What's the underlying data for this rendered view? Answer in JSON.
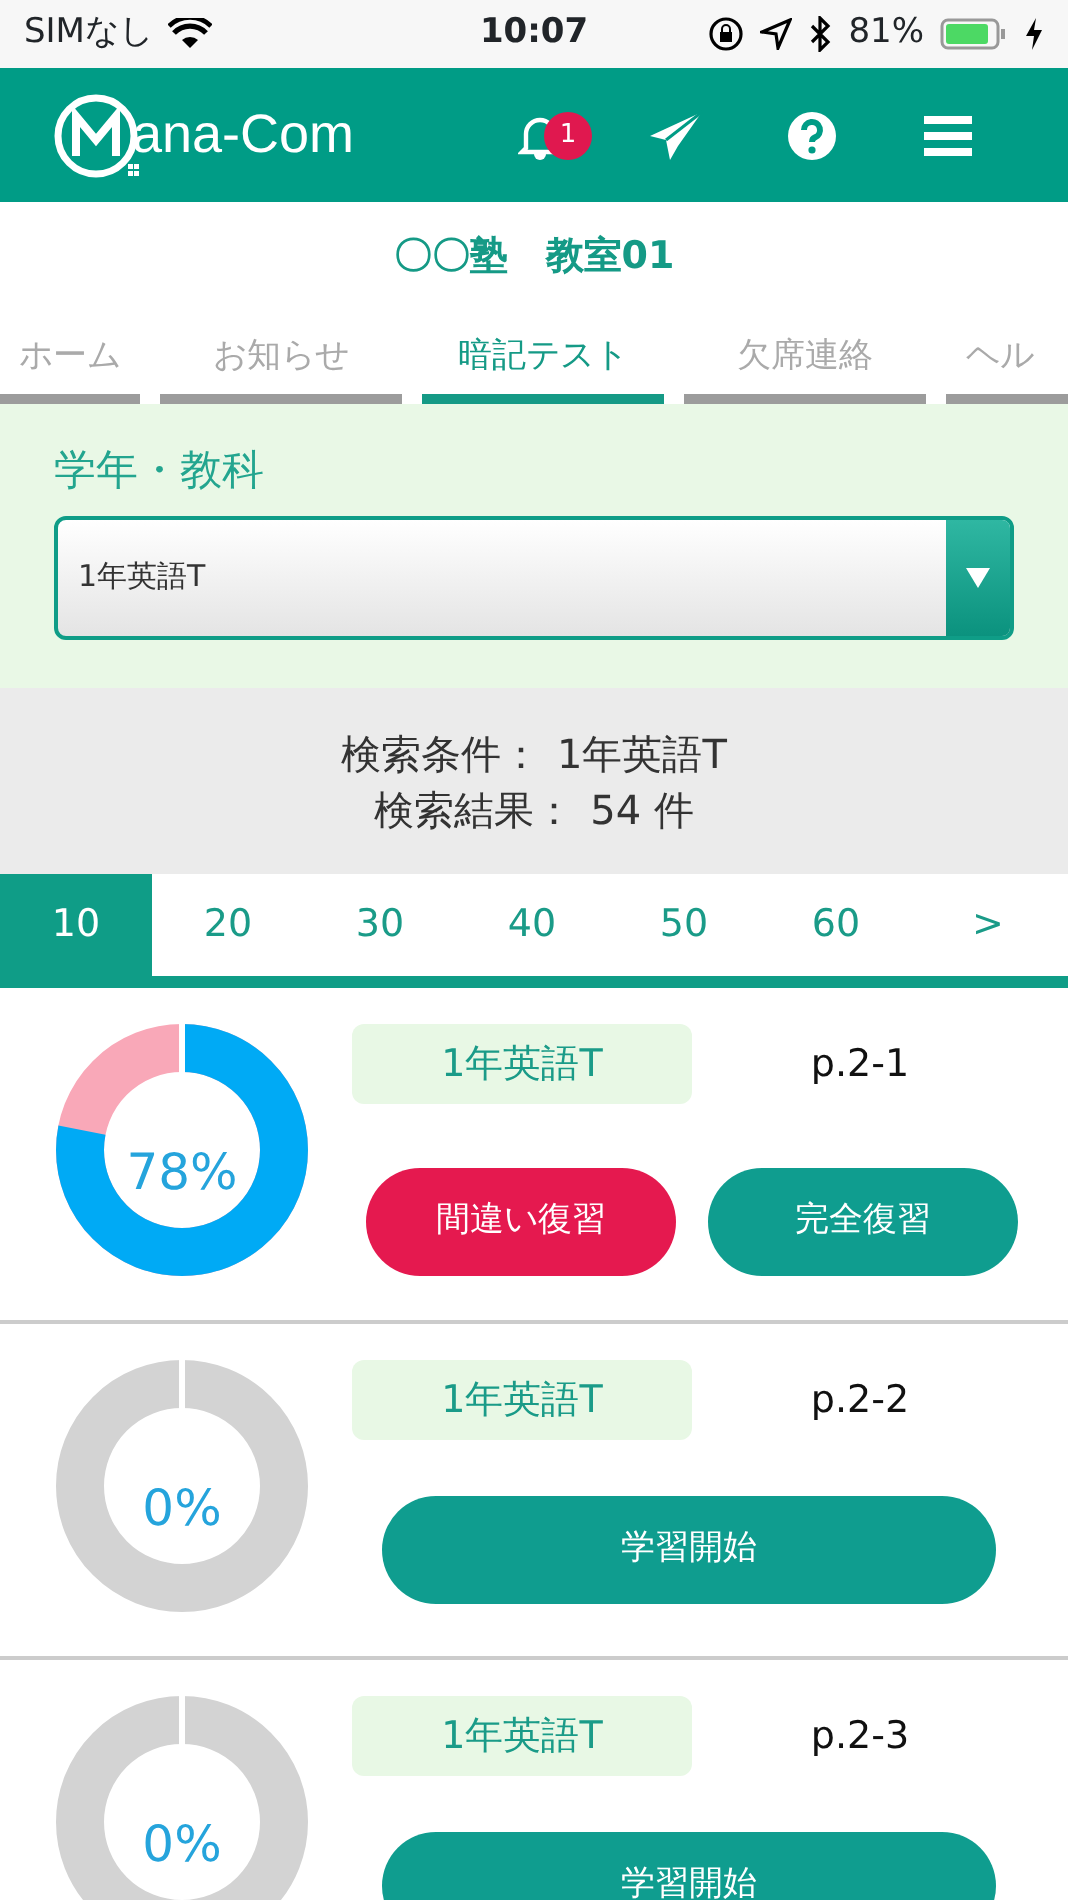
{
  "status_bar": {
    "carrier": "SIMなし",
    "time": "10:07",
    "battery": "81%"
  },
  "header": {
    "logo": "ana-Com",
    "notification_count": "1"
  },
  "school_title": "〇〇塾　教室01",
  "tabs": [
    {
      "label": "ホーム",
      "selected": false
    },
    {
      "label": "お知らせ",
      "selected": false
    },
    {
      "label": "暗記テスト",
      "selected": true
    },
    {
      "label": "欠席連絡",
      "selected": false
    },
    {
      "label": "ヘル",
      "selected": false
    }
  ],
  "filter": {
    "label": "学年・教科",
    "value": "1年英語T"
  },
  "summary": {
    "condition_label": "検索条件：",
    "condition": "1年英語T",
    "result_label": "検索結果：",
    "result": "54 件"
  },
  "pagination": [
    {
      "label": "10",
      "selected": true
    },
    {
      "label": "20",
      "selected": false
    },
    {
      "label": "30",
      "selected": false
    },
    {
      "label": "40",
      "selected": false
    },
    {
      "label": "50",
      "selected": false
    },
    {
      "label": "60",
      "selected": false
    },
    {
      "label": ">",
      "selected": false
    }
  ],
  "items": [
    {
      "kind": "review",
      "level": 0.78,
      "percent": "78%",
      "subject": "1年英語T",
      "page": "p.2-1",
      "buttons": [
        "間違い復習",
        "完全復習"
      ]
    },
    {
      "kind": "start",
      "level": 0,
      "percent": "0%",
      "subject": "1年英語T",
      "page": "p.2-2",
      "buttons": [
        "学習開始"
      ]
    },
    {
      "kind": "start",
      "level": 0,
      "percent": "0%",
      "subject": "1年英語T",
      "page": "p.2-3",
      "buttons": [
        "学習開始"
      ]
    }
  ]
}
